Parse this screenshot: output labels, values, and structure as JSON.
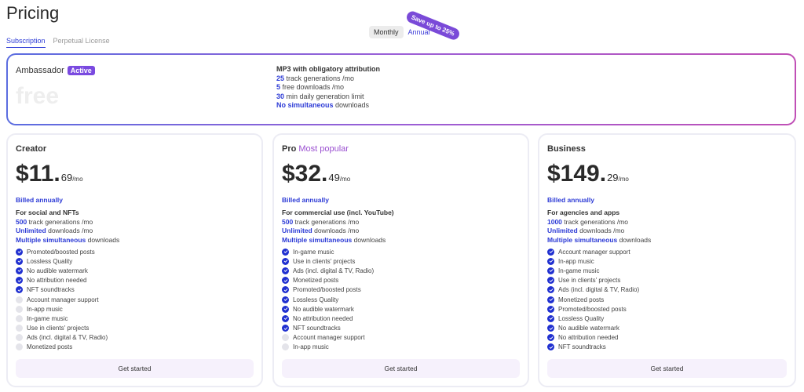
{
  "page": {
    "title": "Pricing"
  },
  "tabs": [
    {
      "label": "Subscription",
      "active": true
    },
    {
      "label": "Perpetual License",
      "active": false
    }
  ],
  "billing_toggle": {
    "monthly": "Monthly",
    "annual": "Annual",
    "badge": "Save up to 25%",
    "selected": "Annual"
  },
  "ambassador": {
    "name": "Ambassador",
    "badge": "Active",
    "price": "free",
    "features_title": "MP3 with obligatory attribution",
    "features": [
      {
        "hl": "25",
        "text": " track generations /mo"
      },
      {
        "hl": "5",
        "text": " free downloads /mo"
      },
      {
        "hl": "30",
        "text": " min daily generation limit"
      },
      {
        "hl": "No simultaneous",
        "text": " downloads"
      }
    ]
  },
  "plans": [
    {
      "name": "Creator",
      "popular": "",
      "price_main": "$11.",
      "price_cents": "69",
      "price_per": "/mo",
      "billed": "Billed annually",
      "summary_title": "For social and NFTs",
      "summary": [
        {
          "hl": "500",
          "text": " track generations /mo"
        },
        {
          "hl": "Unlimited",
          "text": " downloads /mo"
        },
        {
          "hl": "Multiple simultaneous",
          "text": " downloads"
        }
      ],
      "features": [
        {
          "label": "Promoted/boosted posts",
          "included": true
        },
        {
          "label": "Lossless Quality",
          "included": true
        },
        {
          "label": "No audible watermark",
          "included": true
        },
        {
          "label": "No attribution needed",
          "included": true
        },
        {
          "label": "NFT soundtracks",
          "included": true
        },
        {
          "label": "Account manager support",
          "included": false
        },
        {
          "label": "In-app music",
          "included": false
        },
        {
          "label": "In-game music",
          "included": false
        },
        {
          "label": "Use in clients' projects",
          "included": false
        },
        {
          "label": "Ads (incl. digital & TV, Radio)",
          "included": false
        },
        {
          "label": "Monetized posts",
          "included": false
        }
      ],
      "cta": "Get started"
    },
    {
      "name": "Pro",
      "popular": "Most popular",
      "price_main": "$32.",
      "price_cents": "49",
      "price_per": "/mo",
      "billed": "Billed annually",
      "summary_title": "For commercial use (incl. YouTube)",
      "summary": [
        {
          "hl": "500",
          "text": " track generations /mo"
        },
        {
          "hl": "Unlimited",
          "text": " downloads /mo"
        },
        {
          "hl": "Multiple simultaneous",
          "text": " downloads"
        }
      ],
      "features": [
        {
          "label": "In-game music",
          "included": true
        },
        {
          "label": "Use in clients' projects",
          "included": true
        },
        {
          "label": "Ads (incl. digital & TV, Radio)",
          "included": true
        },
        {
          "label": "Monetized posts",
          "included": true
        },
        {
          "label": "Promoted/boosted posts",
          "included": true
        },
        {
          "label": "Lossless Quality",
          "included": true
        },
        {
          "label": "No audible watermark",
          "included": true
        },
        {
          "label": "No attribution needed",
          "included": true
        },
        {
          "label": "NFT soundtracks",
          "included": true
        },
        {
          "label": "Account manager support",
          "included": false
        },
        {
          "label": "In-app music",
          "included": false
        }
      ],
      "cta": "Get started"
    },
    {
      "name": "Business",
      "popular": "",
      "price_main": "$149.",
      "price_cents": "29",
      "price_per": "/mo",
      "billed": "Billed annually",
      "summary_title": "For agencies and apps",
      "summary": [
        {
          "hl": "1000",
          "text": " track generations /mo"
        },
        {
          "hl": "Unlimited",
          "text": " downloads /mo"
        },
        {
          "hl": "Multiple simultaneous",
          "text": " downloads"
        }
      ],
      "features": [
        {
          "label": "Account manager support",
          "included": true
        },
        {
          "label": "In-app music",
          "included": true
        },
        {
          "label": "In-game music",
          "included": true
        },
        {
          "label": "Use in clients' projects",
          "included": true
        },
        {
          "label": "Ads (incl. digital & TV, Radio)",
          "included": true
        },
        {
          "label": "Monetized posts",
          "included": true
        },
        {
          "label": "Promoted/boosted posts",
          "included": true
        },
        {
          "label": "Lossless Quality",
          "included": true
        },
        {
          "label": "No audible watermark",
          "included": true
        },
        {
          "label": "No attribution needed",
          "included": true
        },
        {
          "label": "NFT soundtracks",
          "included": true
        }
      ],
      "cta": "Get started"
    }
  ],
  "colors": {
    "accent": "#2d3bd6",
    "purple": "#7a4ae0",
    "check_on": "#2030d0",
    "check_off": "#e4e4ea"
  },
  "icons": {
    "check": "check-circle-icon"
  }
}
